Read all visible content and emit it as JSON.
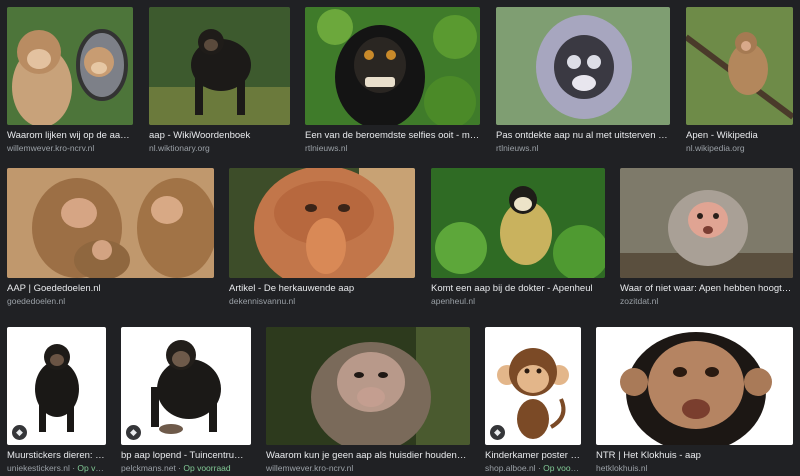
{
  "results": [
    {
      "title": "Waarom lijken wij op de aap? | ...",
      "source": "willemwever.kro-ncrv.nl",
      "badge": false,
      "stock": ""
    },
    {
      "title": "aap - WikiWoordenboek",
      "source": "nl.wiktionary.org",
      "badge": false,
      "stock": ""
    },
    {
      "title": "Een van de beroemdste selfies ooit - maar aa...",
      "source": "rtlnieuws.nl",
      "badge": false,
      "stock": ""
    },
    {
      "title": "Pas ontdekte aap nu al met uitsterven bedrei...",
      "source": "rtlnieuws.nl",
      "badge": false,
      "stock": ""
    },
    {
      "title": "Apen - Wikipedia",
      "source": "nl.wikipedia.org",
      "badge": false,
      "stock": ""
    },
    {
      "title": "AAP | Goededoelen.nl",
      "source": "goededoelen.nl",
      "badge": false,
      "stock": ""
    },
    {
      "title": "Artikel - De herkauwende aap",
      "source": "dekennisvannu.nl",
      "badge": false,
      "stock": ""
    },
    {
      "title": "Komt een aap bij de dokter - Apenheul",
      "source": "apenheul.nl",
      "badge": false,
      "stock": ""
    },
    {
      "title": "Waar of niet waar: Apen hebben hoogtevree...",
      "source": "zozitdat.nl",
      "badge": false,
      "stock": ""
    },
    {
      "title": "Muurstickers dieren: Mu...",
      "source": "uniekestickers.nl",
      "badge": true,
      "stock": "Op voorr..."
    },
    {
      "title": "bp aap lopend - Tuincentrum Pel...",
      "source": "pelckmans.net",
      "badge": true,
      "stock": "Op voorraad"
    },
    {
      "title": "Waarom kun je geen aap als huisdier houden? | Wille...",
      "source": "willemwever.kro-ncrv.nl",
      "badge": false,
      "stock": ""
    },
    {
      "title": "Kinderkamer poster aa...",
      "source": "shop.alboe.nl",
      "badge": true,
      "stock": "Op voorraad"
    },
    {
      "title": "NTR | Het Klokhuis - aap",
      "source": "hetklokhuis.nl",
      "badge": false,
      "stock": ""
    }
  ],
  "stock_separator": " · ",
  "badge_icon": "tag-icon",
  "colors": {
    "background": "#202124",
    "title": "#e8eaed",
    "source": "#9aa0a6",
    "in_stock": "#81c995"
  }
}
